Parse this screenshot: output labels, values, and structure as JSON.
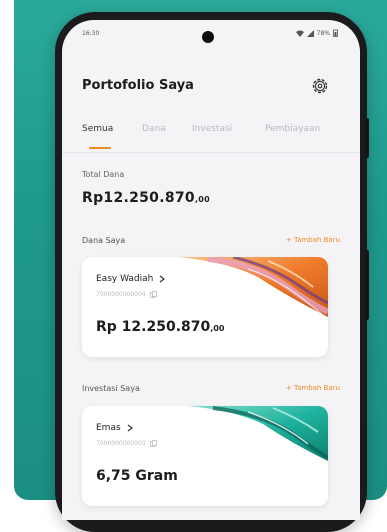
{
  "status_bar": {
    "time": "16:30",
    "battery": "78%"
  },
  "header": {
    "title": "Portofolio Saya"
  },
  "tabs": [
    {
      "label": "Semua"
    },
    {
      "label": "Dana"
    },
    {
      "label": "Investasi"
    },
    {
      "label": "Pembiayaan"
    }
  ],
  "total": {
    "label": "Total Dana",
    "amount": "Rp12.250.870",
    "decimals": ",00"
  },
  "dana_section": {
    "title": "Dana Saya",
    "add_label": "+ Tambah Baru",
    "card": {
      "name": "Easy Wadiah",
      "account": "7000000000004",
      "amount": "Rp 12.250.870",
      "decimals": ",00"
    }
  },
  "investasi_section": {
    "title": "Investasi Saya",
    "add_label": "+ Tambah Baru",
    "card": {
      "name": "Emas",
      "account": "7000000000003",
      "amount": "6,75 Gram"
    }
  },
  "colors": {
    "accent": "#f08a24",
    "teal_bg": "#2aa99b"
  },
  "icons": [
    "settings-icon",
    "chevron-right-icon",
    "copy-icon",
    "wifi-icon",
    "signal-icon",
    "battery-icon"
  ]
}
